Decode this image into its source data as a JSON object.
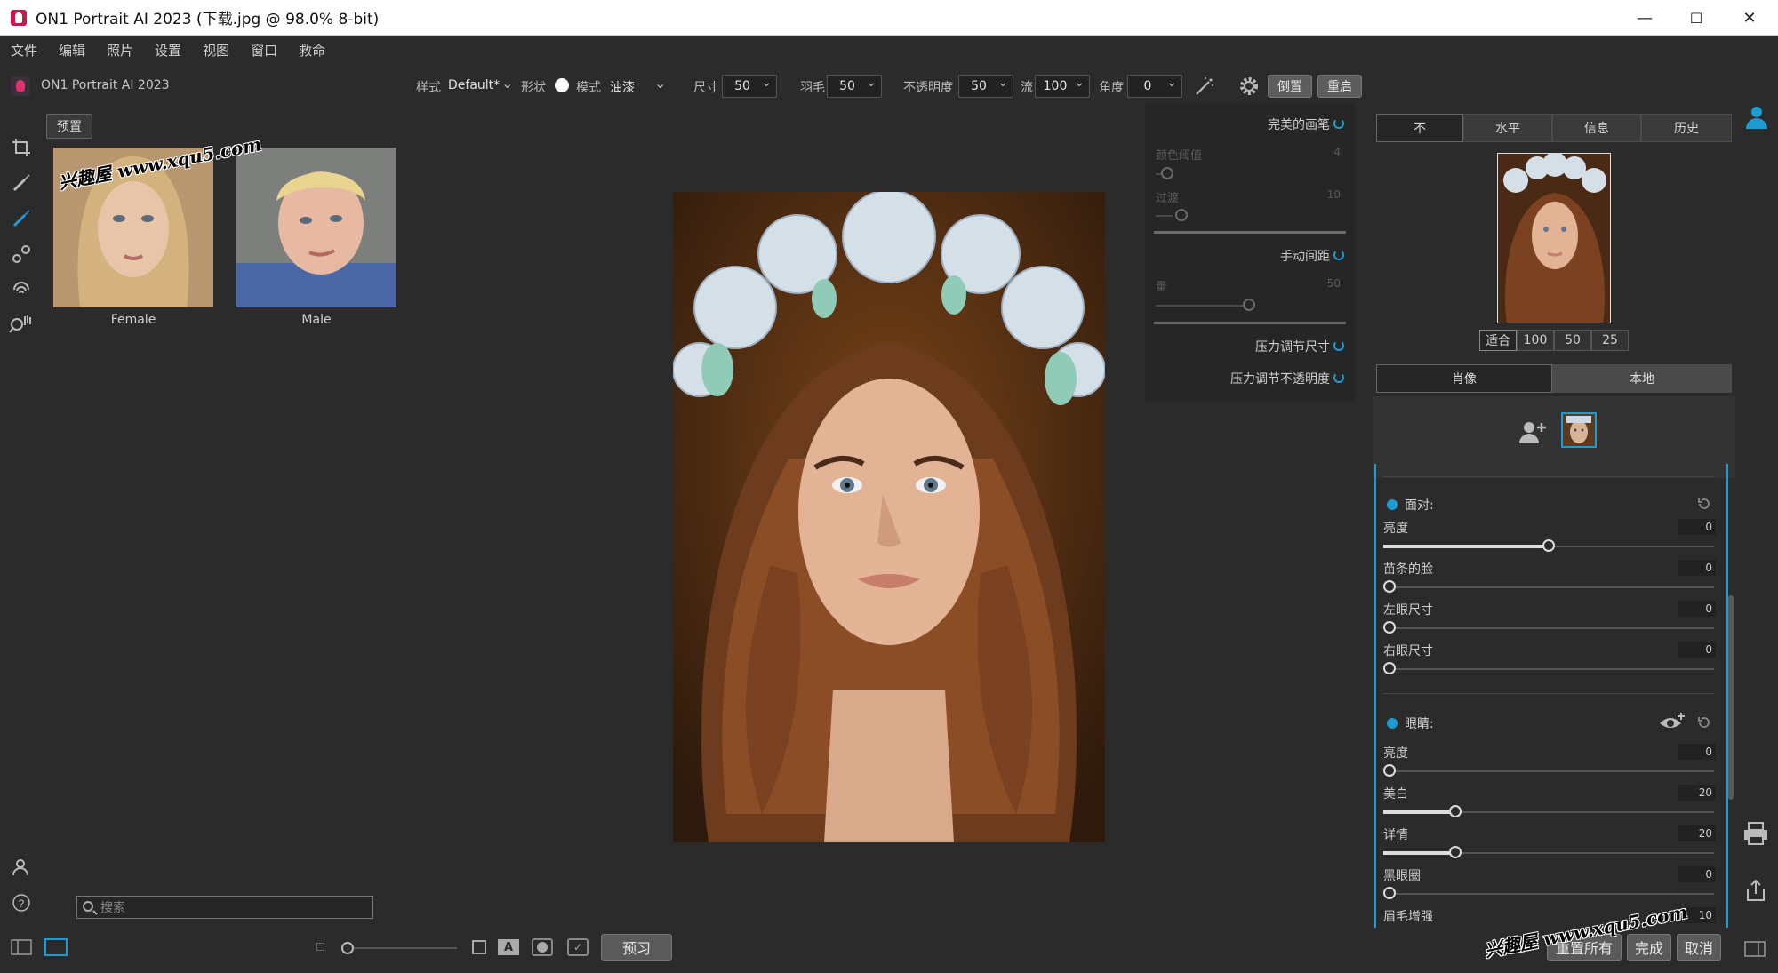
{
  "window": {
    "title": "ON1 Portrait AI 2023 (下载.jpg @ 98.0% 8-bit)",
    "minimize": "—",
    "maximize": "☐",
    "close": "✕"
  },
  "menu": [
    "文件",
    "编辑",
    "照片",
    "设置",
    "视图",
    "窗口",
    "救命"
  ],
  "app_name": "ON1 Portrait AI 2023",
  "toolbar": {
    "style_label": "样式",
    "style_value": "Default*",
    "shape_label": "形状",
    "mode_label": "模式",
    "mode_value": "油漆",
    "size_label": "尺寸",
    "size_value": "50",
    "feather_label": "羽毛",
    "feather_value": "50",
    "opacity_label": "不透明度",
    "opacity_value": "50",
    "flow_label": "流",
    "flow_value": "100",
    "angle_label": "角度",
    "angle_value": "0",
    "invert_button": "倒置",
    "reset_button": "重启"
  },
  "presets": {
    "tab_label": "预置",
    "items": [
      {
        "label": "Female"
      },
      {
        "label": "Male"
      }
    ]
  },
  "brush_options": {
    "perfect_brush": "完美的画笔",
    "color_threshold": "颜色阈值",
    "color_threshold_value": "4",
    "transition": "过渡",
    "transition_value": "10",
    "manual_spacing": "手动间距",
    "amount": "量",
    "amount_value": "50",
    "pressure_size": "压力调节尺寸",
    "pressure_opacity": "压力调节不透明度"
  },
  "right_tabs": [
    "不",
    "水平",
    "信息",
    "历史"
  ],
  "zoom_buttons": [
    "适合",
    "100",
    "50",
    "25"
  ],
  "mode_tabs": [
    "肖像",
    "本地"
  ],
  "face_section": {
    "title": "面对:",
    "adjustments": [
      {
        "label": "亮度",
        "value": "0"
      },
      {
        "label": "苗条的脸",
        "value": "0"
      },
      {
        "label": "左眼尺寸",
        "value": "0"
      },
      {
        "label": "右眼尺寸",
        "value": "0"
      }
    ]
  },
  "eyes_section": {
    "title": "眼睛:",
    "adjustments": [
      {
        "label": "亮度",
        "value": "0"
      },
      {
        "label": "美白",
        "value": "20"
      },
      {
        "label": "详情",
        "value": "20"
      },
      {
        "label": "黑眼圈",
        "value": "0"
      },
      {
        "label": "眉毛增强",
        "value": "10"
      }
    ]
  },
  "search": {
    "placeholder": "搜索"
  },
  "bottom": {
    "preview_button": "预习",
    "reset_all_button": "重置所有",
    "done_button": "完成",
    "cancel_button": "取消"
  },
  "watermark": "兴趣屋 www.xqu5.com",
  "colors": {
    "accent": "#1e9bd0",
    "background": "#2b2b2b"
  }
}
